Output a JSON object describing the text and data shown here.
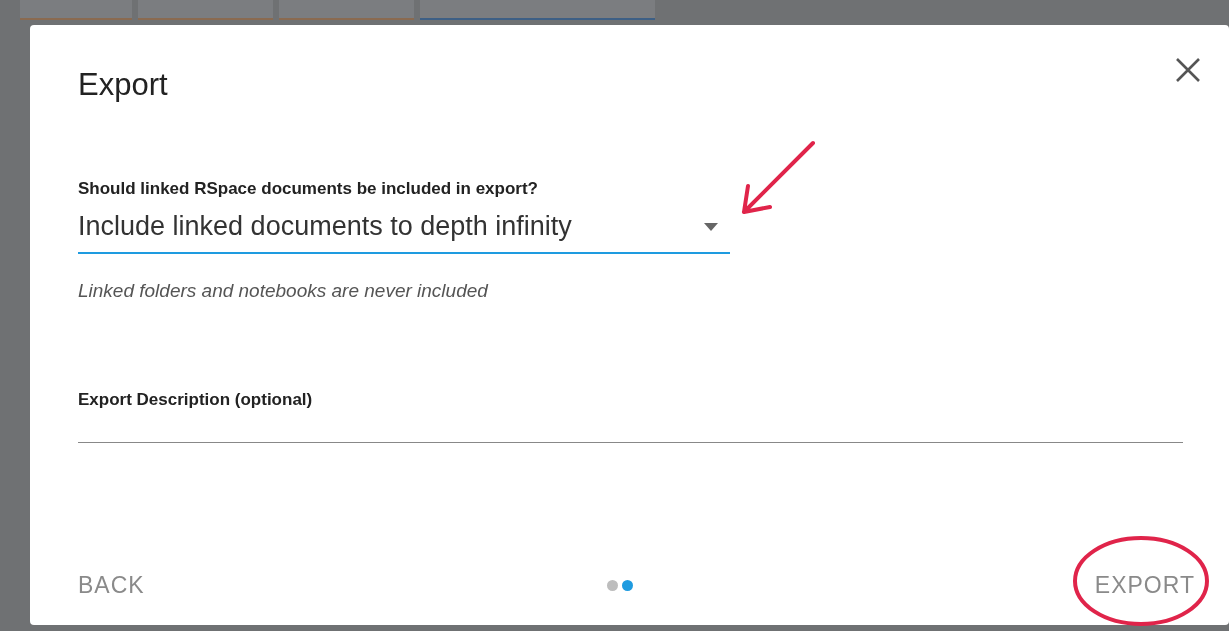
{
  "dialog": {
    "title": "Export",
    "link_depth": {
      "label": "Should linked RSpace documents be included in export?",
      "value": "Include linked documents to depth infinity",
      "helper": "Linked folders and notebooks are never included"
    },
    "description": {
      "label": "Export Description (optional)"
    },
    "footer": {
      "back": "BACK",
      "export": "EXPORT",
      "steps": [
        {
          "selected": false
        },
        {
          "selected": true
        }
      ]
    }
  }
}
